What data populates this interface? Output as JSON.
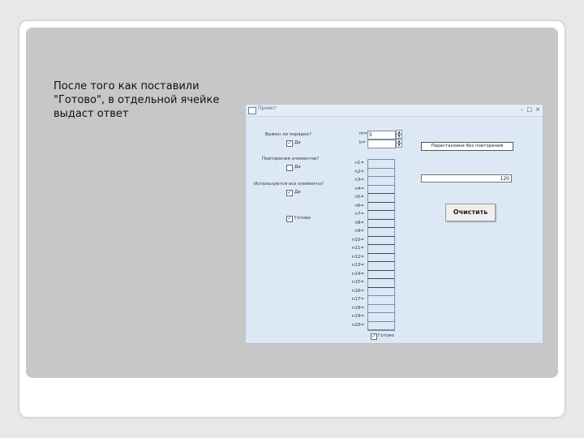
{
  "slide": {
    "caption": "После того как поставили\n\"Готово\", в отдельной ячейке\nвыдаст ответ"
  },
  "window": {
    "title": "Проект",
    "controls": {
      "minimize": "–",
      "maximize": "□",
      "close": "×"
    }
  },
  "form": {
    "q_order": "Важен ли порядок?",
    "q_order_cb": "Да",
    "q_repeat": "Повторения элементов?",
    "q_repeat_cb": "Да",
    "q_all": "Используются все элементы?",
    "q_all_cb": "Да",
    "ready_cb": "Готово",
    "m_label": "m=",
    "m_value": "5",
    "k_label": "k=",
    "k_value": "",
    "n_labels": [
      "n1=",
      "n2=",
      "n3=",
      "n4=",
      "n5=",
      "n6=",
      "n7=",
      "n8=",
      "n9=",
      "n10=",
      "n11=",
      "n12=",
      "n13=",
      "n14=",
      "n15=",
      "n16=",
      "n17=",
      "n18=",
      "n19=",
      "n20="
    ],
    "bottom_ready": "Готово",
    "combo_value": "Перестановки без повторений",
    "result_value": "120",
    "clear_button": "Очистить"
  },
  "icons": {
    "checkbox_checked": "checkmark",
    "spin_up": "arrow-up",
    "spin_down": "arrow-down"
  },
  "colors": {
    "window_bg": "#dce8f5",
    "panel_bg": "#c7c7c7"
  }
}
